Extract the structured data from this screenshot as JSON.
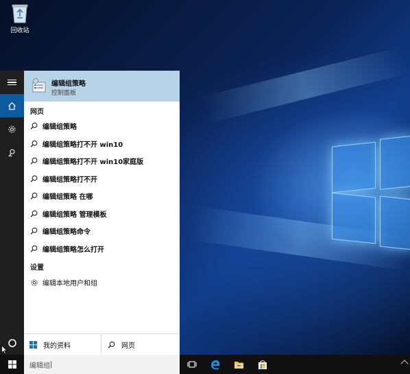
{
  "desktop": {
    "recycle_bin_label": "回收站"
  },
  "start_rail": {
    "items": [
      {
        "icon": "hamburger-icon"
      },
      {
        "icon": "home-icon"
      },
      {
        "icon": "gear-icon"
      },
      {
        "icon": "feedback-icon"
      },
      {
        "icon": "cortana-circle-icon"
      }
    ]
  },
  "search_results": {
    "best_match": {
      "title": "编辑组策略",
      "subtitle": "控制面板",
      "icon": "group-policy-icon"
    },
    "web_section_label": "网页",
    "web_results": [
      "编辑组策略",
      "编辑组策略打不开 win10",
      "编辑组策略打不开 win10家庭版",
      "编辑组策略打不开",
      "编辑组策略 在哪",
      "编辑组策略 管理模板",
      "编辑组策略命令",
      "编辑组策略怎么打开"
    ],
    "settings_section_label": "设置",
    "settings_results": [
      "编辑本地用户和组"
    ],
    "bottom": {
      "my_stuff_label": "我的资料",
      "web_label": "网页"
    }
  },
  "taskbar": {
    "search_value": "编辑组",
    "icons": [
      "windows-start-icon",
      "task-view-icon",
      "edge-icon",
      "file-explorer-icon",
      "store-icon"
    ],
    "accent": "#0078d7"
  }
}
